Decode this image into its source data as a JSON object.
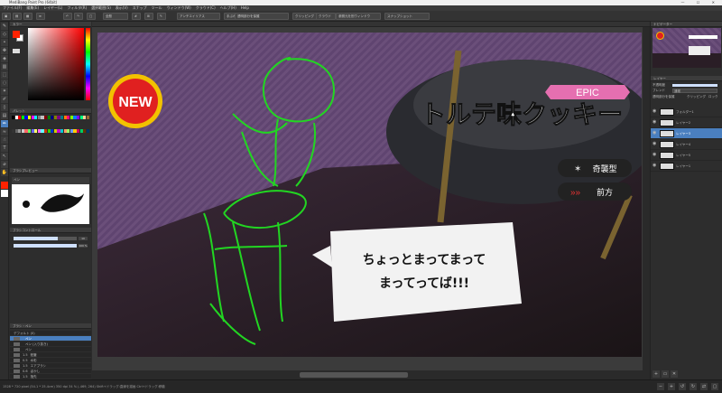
{
  "window": {
    "title": "MediBang Paint Pro (64bit)",
    "controls": "—  ☐  ✕"
  },
  "menu": [
    "ファイル(F)",
    "編集(E)",
    "レイヤー(L)",
    "フィルタ(R)",
    "選択範囲(S)",
    "表示(V)",
    "スナップ",
    "ツール",
    "ウィンドウ(W)",
    "クラウド(C)",
    "ヘルプ(H)",
    "Help"
  ],
  "toolbar": {
    "brush_select": "全般",
    "antialias": "アンチエイリアス",
    "stroke_correct": "手ぶれ補正",
    "transparency": "透明部分を保護",
    "clip": "クリッピング",
    "save_cloud": "クラウド",
    "reference": "参照元を別ウィンドウ",
    "snapshot": "スナップショット"
  },
  "left_panel": {
    "color_title": "カラー",
    "palette_title": "パレット",
    "brush_preview_title": "ブラシプレビュー",
    "brush_preview_name": "ペン",
    "brush_control_title": "ブラシコントロール",
    "brush_size_value": "10",
    "brush_opacity_value": "100 %",
    "brush_list_title": "ブラシ・ペン",
    "brush_group": "デフォルト (0)",
    "brushes": [
      "ペン",
      "ペン (入り抜き)",
      "ペン",
      "鉛筆",
      "水彩",
      "エアブラシ",
      "ぼかし",
      "指先",
      "消しゴム",
      "塗りつぶし"
    ],
    "brush_sizes": [
      "",
      "",
      "",
      "1.5",
      "0.5",
      "1.5",
      "0.6",
      "1.5",
      "1.5",
      "10"
    ]
  },
  "colors": {
    "fg": "#ff2200",
    "bg": "#ffffff",
    "palette": [
      "#000000",
      "#ffffff",
      "#ff0000",
      "#00ff00",
      "#0000ff",
      "#ffff00",
      "#ff00ff",
      "#00ffff",
      "#808080",
      "#c0c0c0",
      "#800000",
      "#008000",
      "#000080",
      "#808000",
      "#800080",
      "#008080",
      "#ff8000",
      "#ff0080",
      "#80ff00",
      "#0080ff",
      "#8000ff",
      "#00ff80",
      "#ffcc99",
      "#996633",
      "#333333",
      "#666666",
      "#999999",
      "#cccccc",
      "#ff6666",
      "#66ff66",
      "#6666ff",
      "#ffff66",
      "#ff66ff",
      "#66ffff",
      "#cc3300",
      "#33cc00",
      "#0033cc",
      "#cccc00",
      "#cc00cc",
      "#00cccc",
      "#ff9966",
      "#99ff66",
      "#6699ff",
      "#ffcc00",
      "#cc0066",
      "#00cc66",
      "#663300",
      "#003366"
    ]
  },
  "canvas_art": {
    "badge": "NEW",
    "tier": "EPIC",
    "name": "トルテ味クッキー",
    "type1": "奇襲型",
    "type2": "前方",
    "speech_line1": "ちょっとまってまって",
    "speech_line2": "まってってば!!!"
  },
  "right_panel": {
    "navigator_title": "ナビゲーター",
    "layer_title": "レイヤー",
    "opacity_label": "不透明度",
    "blend_label": "ブレンド",
    "blend_value": "通常",
    "protect_label": "透明部分を保護",
    "clip_label": "クリッピング",
    "lock_label": "ロック",
    "layers": [
      {
        "name": "フォルダー1",
        "selected": false
      },
      {
        "name": "レイヤー2",
        "selected": false
      },
      {
        "name": "レイヤー3",
        "selected": true
      },
      {
        "name": "レイヤー4",
        "selected": false
      },
      {
        "name": "レイヤー5",
        "selected": false
      },
      {
        "name": "レイヤー1",
        "selected": false
      }
    ]
  },
  "status": {
    "text": "1528 * 720 pixel (54.1 * 25.4cm)  350 dpi  34 %  (-469, 264)  Shift+ドラッグ:直線を描画  Ctrl+ドラッグ:移動"
  }
}
